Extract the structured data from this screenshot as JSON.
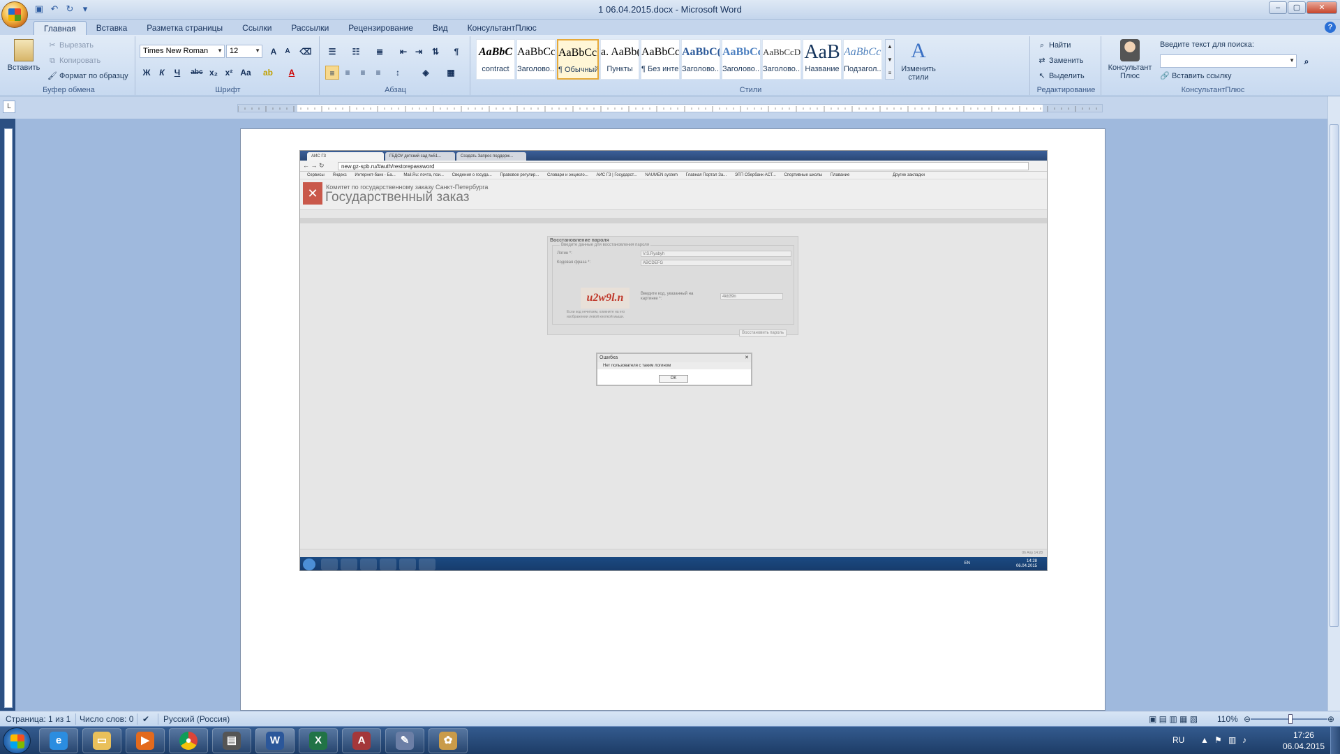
{
  "window": {
    "title": "1 06.04.2015.docx - Microsoft Word",
    "controls": {
      "minimize": "–",
      "maximize": "▢",
      "close": "✕"
    }
  },
  "ribbon_tabs": [
    {
      "label": "Главная",
      "active": true
    },
    {
      "label": "Вставка"
    },
    {
      "label": "Разметка страницы"
    },
    {
      "label": "Ссылки"
    },
    {
      "label": "Рассылки"
    },
    {
      "label": "Рецензирование"
    },
    {
      "label": "Вид"
    },
    {
      "label": "КонсультантПлюс"
    }
  ],
  "clipboard": {
    "paste": "Вставить",
    "cut": "Вырезать",
    "copy": "Копировать",
    "format_painter": "Формат по образцу",
    "group_label": "Буфер обмена"
  },
  "font": {
    "family": "Times New Roman",
    "size": "12",
    "group_label": "Шрифт",
    "bold": "Ж",
    "italic": "К",
    "underline": "Ч",
    "strike": "abc",
    "subscript": "x₂",
    "superscript": "x²",
    "case": "Aa",
    "grow": "A",
    "shrink": "A"
  },
  "paragraph": {
    "group_label": "Абзац"
  },
  "styles": {
    "group_label": "Стили",
    "items": [
      {
        "preview": "AaBbC",
        "name": "contract"
      },
      {
        "preview": "AaBbCcI",
        "name": "Заголово..."
      },
      {
        "preview": "AaBbCcI",
        "name": "¶ Обычный",
        "active": true
      },
      {
        "preview": "a. AaBb(",
        "name": "Пункты"
      },
      {
        "preview": "AaBbCcI",
        "name": "¶ Без инте..."
      },
      {
        "preview": "AaBbC(",
        "name": "Заголово..."
      },
      {
        "preview": "AaBbCcI",
        "name": "Заголово..."
      },
      {
        "preview": "AaBbCcDd",
        "name": "Заголово..."
      },
      {
        "preview": "AaB",
        "name": "Название"
      },
      {
        "preview": "AaBbCc.",
        "name": "Подзагол..."
      }
    ],
    "change_styles": "Изменить стили"
  },
  "editing": {
    "find": "Найти",
    "replace": "Заменить",
    "select": "Выделить",
    "group_label": "Редактирование"
  },
  "consultant": {
    "button": "Консультант Плюс",
    "search_label": "Введите текст для поиска:",
    "insert_link": "Вставить ссылку",
    "group_label": "КонсультантПлюс"
  },
  "embedded": {
    "tabs": [
      "АИС ГЗ",
      "ГБДОУ детский сад №51...",
      "Создать Запрос поддерж..."
    ],
    "url": "new.gz-spb.ru/#auth/restorepassword",
    "bookmarks": [
      "Сервисы",
      "Яндекс",
      "Интернет-банк - Ба...",
      "Mail.Ru: почта, пои...",
      "Сведения о госуда...",
      "Правовое регулир...",
      "Словари и энцикло...",
      "АИС ГЗ | Государст...",
      "NAUMEN system",
      "Главная Портал За...",
      "ЭТП Сбербанк-АСТ...",
      "Спортивные школы",
      "Плавание",
      "Другие закладки"
    ],
    "org": "Комитет по государственному заказу Санкт-Петербурга",
    "site_name": "Государственный заказ",
    "form_title": "Восстановление пароля",
    "legend": "Введите данные для восстановления пароля",
    "login_label": "Логин *:",
    "login_value": "V.S.Ryabyh",
    "phrase_label": "Кодовая фраза *:",
    "phrase_value": "ABCDEFG",
    "captcha_text": "u2w9l.n",
    "captcha_label": "Введите код, указанный на картинке *:",
    "captcha_value": "4kb39n",
    "captcha_hint": "Если код нечитаем, кликните на его изображении левой кнопкой мыши.",
    "restore_button": "Восстановить пароль",
    "dialog_title": "Ошибка",
    "dialog_message": "Нет пользователя с таким логином",
    "dialog_ok": "OK",
    "status_time": "06 Апр 14:28",
    "tray_lang": "EN",
    "tray_time": "14:28",
    "tray_date": "06.04.2015"
  },
  "statusbar": {
    "page": "Страница: 1 из 1",
    "words": "Число слов: 0",
    "language": "Русский (Россия)",
    "zoom": "110%"
  },
  "taskbar": {
    "lang": "RU",
    "time": "17:26",
    "date": "06.04.2015"
  }
}
